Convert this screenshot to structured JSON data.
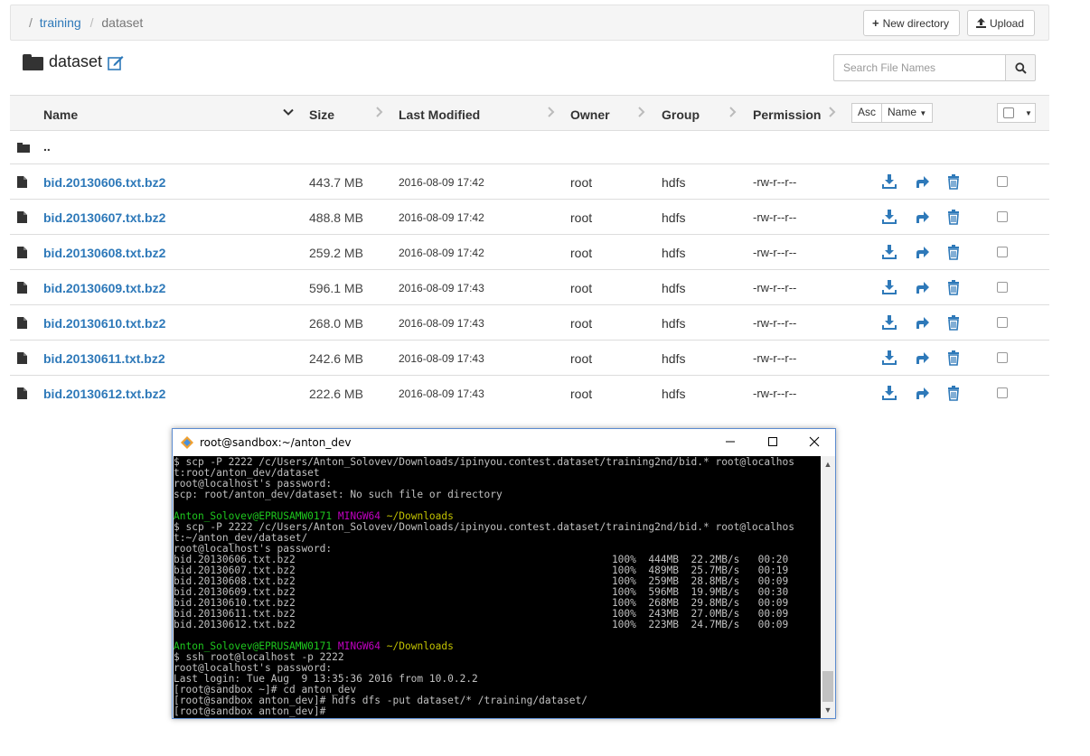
{
  "breadcrumb": {
    "root_sep": "/",
    "training": "training",
    "sep": "/",
    "dataset": "dataset"
  },
  "toolbar": {
    "new_directory": "New directory",
    "upload": "Upload"
  },
  "title": "dataset",
  "search": {
    "placeholder": "Search File Names"
  },
  "columns": {
    "name": "Name",
    "size": "Size",
    "last_modified": "Last Modified",
    "owner": "Owner",
    "group": "Group",
    "permission": "Permission",
    "asc": "Asc",
    "sort_by": "Name"
  },
  "parent_dir": "..",
  "files": [
    {
      "name": "bid.20130606.txt.bz2",
      "size": "443.7 MB",
      "modified": "2016-08-09 17:42",
      "owner": "root",
      "group": "hdfs",
      "permission": "-rw-r--r--"
    },
    {
      "name": "bid.20130607.txt.bz2",
      "size": "488.8 MB",
      "modified": "2016-08-09 17:42",
      "owner": "root",
      "group": "hdfs",
      "permission": "-rw-r--r--"
    },
    {
      "name": "bid.20130608.txt.bz2",
      "size": "259.2 MB",
      "modified": "2016-08-09 17:42",
      "owner": "root",
      "group": "hdfs",
      "permission": "-rw-r--r--"
    },
    {
      "name": "bid.20130609.txt.bz2",
      "size": "596.1 MB",
      "modified": "2016-08-09 17:43",
      "owner": "root",
      "group": "hdfs",
      "permission": "-rw-r--r--"
    },
    {
      "name": "bid.20130610.txt.bz2",
      "size": "268.0 MB",
      "modified": "2016-08-09 17:43",
      "owner": "root",
      "group": "hdfs",
      "permission": "-rw-r--r--"
    },
    {
      "name": "bid.20130611.txt.bz2",
      "size": "242.6 MB",
      "modified": "2016-08-09 17:43",
      "owner": "root",
      "group": "hdfs",
      "permission": "-rw-r--r--"
    },
    {
      "name": "bid.20130612.txt.bz2",
      "size": "222.6 MB",
      "modified": "2016-08-09 17:43",
      "owner": "root",
      "group": "hdfs",
      "permission": "-rw-r--r--"
    }
  ],
  "terminal": {
    "title": "root@sandbox:~/anton_dev",
    "colors": {
      "prompt_user": "#1ec81e",
      "prompt_host": "#c000c0",
      "prompt_path": "#c0c000",
      "text": "#c0c0c0"
    },
    "lines": [
      [
        {
          "t": "$ scp -P 2222 /c/Users/Anton_Solovev/Downloads/ipinyou.contest.dataset/training2nd/bid.* root@localhos"
        }
      ],
      [
        {
          "t": "t:root/anton_dev/dataset"
        }
      ],
      [
        {
          "t": "root@localhost's password:"
        }
      ],
      [
        {
          "t": "scp: root/anton_dev/dataset: No such file or directory"
        }
      ],
      [
        {
          "t": ""
        }
      ],
      [
        {
          "t": "Anton_Solovev@EPRUSAMW0171",
          "c": "g"
        },
        {
          "t": " "
        },
        {
          "t": "MINGW64",
          "c": "m"
        },
        {
          "t": " "
        },
        {
          "t": "~/Downloads",
          "c": "y"
        }
      ],
      [
        {
          "t": "$ scp -P 2222 /c/Users/Anton_Solovev/Downloads/ipinyou.contest.dataset/training2nd/bid.* root@localhos"
        }
      ],
      [
        {
          "t": "t:~/anton_dev/dataset/"
        }
      ],
      [
        {
          "t": "root@localhost's password:"
        }
      ],
      [
        {
          "t": "bid.20130606.txt.bz2                                                    100%  444MB  22.2MB/s   00:20"
        }
      ],
      [
        {
          "t": "bid.20130607.txt.bz2                                                    100%  489MB  25.7MB/s   00:19"
        }
      ],
      [
        {
          "t": "bid.20130608.txt.bz2                                                    100%  259MB  28.8MB/s   00:09"
        }
      ],
      [
        {
          "t": "bid.20130609.txt.bz2                                                    100%  596MB  19.9MB/s   00:30"
        }
      ],
      [
        {
          "t": "bid.20130610.txt.bz2                                                    100%  268MB  29.8MB/s   00:09"
        }
      ],
      [
        {
          "t": "bid.20130611.txt.bz2                                                    100%  243MB  27.0MB/s   00:09"
        }
      ],
      [
        {
          "t": "bid.20130612.txt.bz2                                                    100%  223MB  24.7MB/s   00:09"
        }
      ],
      [
        {
          "t": ""
        }
      ],
      [
        {
          "t": "Anton_Solovev@EPRUSAMW0171",
          "c": "g"
        },
        {
          "t": " "
        },
        {
          "t": "MINGW64",
          "c": "m"
        },
        {
          "t": " "
        },
        {
          "t": "~/Downloads",
          "c": "y"
        }
      ],
      [
        {
          "t": "$ ssh root@localhost -p 2222"
        }
      ],
      [
        {
          "t": "root@localhost's password:"
        }
      ],
      [
        {
          "t": "Last login: Tue Aug  9 13:35:36 2016 from 10.0.2.2"
        }
      ],
      [
        {
          "t": "[root@sandbox ~]# cd anton_dev"
        }
      ],
      [
        {
          "t": "[root@sandbox anton_dev]# hdfs dfs -put dataset/* /training/dataset/"
        }
      ],
      [
        {
          "t": "[root@sandbox anton_dev]# "
        }
      ]
    ]
  },
  "icons": {
    "folder": "folder-icon",
    "edit": "edit-icon",
    "search": "search-icon",
    "download": "download-icon",
    "move": "move-icon",
    "delete": "trash-icon",
    "file": "file-icon",
    "link_color": "#2e79b9"
  }
}
